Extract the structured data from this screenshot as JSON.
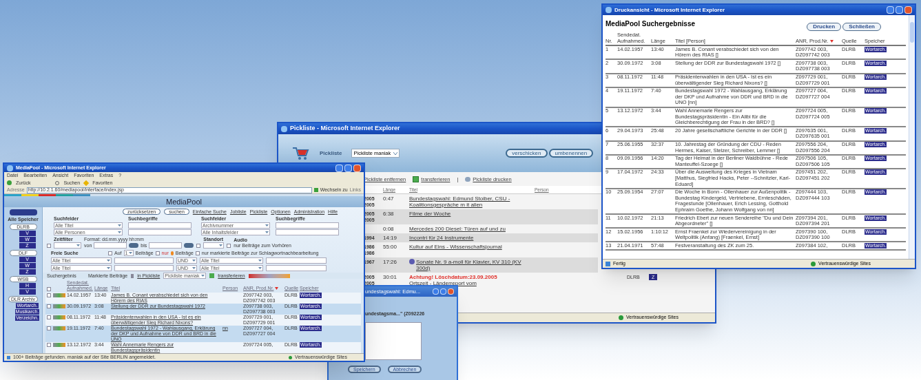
{
  "print_window": {
    "title": "Druckansicht - Microsoft Internet Explorer",
    "heading": "MediaPool Suchergebnisse",
    "buttons": [
      "Drucken",
      "Schließen"
    ],
    "columns": [
      {
        "label": "Nr.",
        "sorted": false
      },
      {
        "label": "Sendedat. Aufnahmed.",
        "sorted": false
      },
      {
        "label": "Länge",
        "sorted": false
      },
      {
        "label": "Titel [Person]",
        "sorted": false
      },
      {
        "label": "ANR, Prod.Nr.",
        "sorted": true
      },
      {
        "label": "Quelle",
        "sorted": false
      },
      {
        "label": "Speicher",
        "sorted": false
      }
    ],
    "rows": [
      {
        "nr": "1",
        "date": "14.02.1957",
        "length": "13:40",
        "title": "James B. Conant verabschiedet sich von den Hörern des RIAS []",
        "anr": "Z097742 003, DZ097742 003",
        "source": "DLRB",
        "storage": "Wortarch."
      },
      {
        "nr": "2",
        "date": "30.09.1972",
        "length": "3:08",
        "title": "Stellung der DDR zur Bundestagswahl 1972 []",
        "anr": "Z097738 003, DZ097738 003",
        "source": "DLRB",
        "storage": "Wortarch."
      },
      {
        "nr": "3",
        "date": "08.11.1972",
        "length": "11:48",
        "title": "Präsidentenwahlen in den USA - Ist es ein überwältigender Sieg Richard Nixons? []",
        "anr": "Z097729 001, DZ097729 001",
        "source": "DLRB",
        "storage": "Wortarch."
      },
      {
        "nr": "4",
        "date": "19.11.1972",
        "length": "7:40",
        "title": "Bundestagswahl 1972 - Wahlausgang, Erklärung der DKP und Aufnahme von DDR und BRD in die UNO [nn]",
        "anr": "Z097727 004, DZ097727 004",
        "source": "DLRB",
        "storage": "Wortarch."
      },
      {
        "nr": "5",
        "date": "13.12.1972",
        "length": "3:44",
        "title": "Wahl Annemarie Rengers zur Bundestagspräsidentin - Ein Alibi für die Gleichberechtigung der Frau in der BRD? []",
        "anr": "Z097724 005, DZ097724 005",
        "source": "DLRB",
        "storage": "Wortarch."
      },
      {
        "nr": "6",
        "date": "29.04.1973",
        "length": "25:48",
        "title": "20 Jahre gesellschaftliche Gerichte in der DDR []",
        "anr": "Z097635 001, DZ097635 001",
        "source": "DLRB",
        "storage": "Wortarch."
      },
      {
        "nr": "7",
        "date": "25.06.1955",
        "length": "32:37",
        "title": "10. Jahrestag der Gründung der CDU - Reden Hermes, Kaiser, Stelzer, Schreiber, Lemmer []",
        "anr": "Z097556 204, DZ097556 204",
        "source": "DLRB",
        "storage": "Wortarch."
      },
      {
        "nr": "8",
        "date": "09.09.1956",
        "length": "14:20",
        "title": "Tag der Heimat in der Berliner Waldbühne - Rede Manteuffel-Szoege []",
        "anr": "Z097506 105, DZ097506 105",
        "source": "DLRB",
        "storage": "Wortarch."
      },
      {
        "nr": "9",
        "date": "17.04.1972",
        "length": "24:33",
        "title": "Über die Ausweitung des Krieges in Vietnam [Matthus, Siegfried Hacks, Peter --Schnitzler, Karl-Eduard]",
        "anr": "Z097451 202, DZ097451 202",
        "source": "DLRB",
        "storage": "Wortarch."
      },
      {
        "nr": "10",
        "date": "25.09.1954",
        "length": "27:07",
        "title": "Die Woche in Bonn - Ollenhauer zur Außenpolitik - Bundestag Kindergeld, Vertriebene, Ernteschäden, Fragestunde [Ollenhauer, Erich Lessing, Gotthold Ephraim Goethe, Johann Wolfgang von nn]",
        "anr": "Z097444 103, DZ097444 103",
        "source": "DLRB",
        "storage": "Wortarch."
      },
      {
        "nr": "11",
        "date": "10.02.1972",
        "length": "21:13",
        "title": "Friedrich Ebert zur neuen Sendereihe \"Du und Dein Abgeordneter\" []",
        "anr": "Z097394 201, DZ097394 201",
        "source": "DLRB",
        "storage": "Wortarch."
      },
      {
        "nr": "12",
        "date": "15.02.1956",
        "length": "1:10:12",
        "title": "Ernst Fraenkel zur Wiedervereinigung in der Weltpolitik (Anfang) [Fraenkel, Ernst]",
        "anr": "Z097390 100, DZ097390 100",
        "source": "DLRB",
        "storage": "Wortarch."
      },
      {
        "nr": "13",
        "date": "21.04.1971",
        "length": "57:48",
        "title": "Festveranstaltung des ZK zum 25.",
        "anr": "Z097384 102,",
        "source": "DLRB",
        "storage": "Wortarch."
      }
    ],
    "status": "Fertig",
    "zone": "Vertrauenswürdige Sites"
  },
  "pick_window": {
    "title": "Pickliste - Microsoft Internet Explorer",
    "label": "Pickliste",
    "select": "Pickliste maniak",
    "buttons": [
      "verschicken",
      "umbenennen"
    ],
    "actions": [
      "Pickliste entfernen",
      "transferieren",
      "Pickliste drucken"
    ],
    "separator": "|",
    "columns": [
      "Länge",
      "Titel",
      "Person"
    ],
    "rows": [
      {
        "years": "2005 2005",
        "length": "0:47",
        "title": "Bundestagswahl: Edmund Stoiber, CSU - Koalitionsgespräche m it allen",
        "shaded": false
      },
      {
        "years": "2005 2005",
        "length": "6:38",
        "title": "Filme der Woche",
        "shaded": true
      },
      {
        "length": "0:08",
        "title": "Mercedes 200 Diesel: Türen auf und zu",
        "shaded": false
      },
      {
        "years": "1994",
        "length": "14:19",
        "title": "Incontri für 24 Instrumente",
        "shaded": true
      },
      {
        "years": "1986 1986",
        "length": "55:00",
        "title": "Kultur auf Eins - Wissenschaftsjournal",
        "shaded": false
      },
      {
        "years": "1967",
        "length": "17:26",
        "title": "Sonate Nr. 9 a-moll für Klavier, KV 310 (KV 300d)",
        "kind": "music",
        "shaded": true
      },
      {
        "years": "2005 2005",
        "length": "30:01",
        "warning": "Achtung! Löschdatum:23.09.2005",
        "title": "Ortszeit - Länderreport vom",
        "source": "DLRB",
        "storage": "Z",
        "shaded": false
      }
    ],
    "zone": "Vertrauenswürdige Sites"
  },
  "dialog": {
    "title": "undestagswahl: Edmu...",
    "label": "undestagsma...\" (Z092226",
    "buttons": [
      "Speichern",
      "Abbrechen"
    ]
  },
  "main_window": {
    "title": "MediaPool - Microsoft Internet Explorer",
    "menu": [
      "Datei",
      "Bearbeiten",
      "Ansicht",
      "Favoriten",
      "Extras",
      "?"
    ],
    "toolbar": [
      "Zurück",
      "Suchen",
      "Favoriten"
    ],
    "address_label": "Adresse",
    "url": "http://10.2.1.60/mediapool/interface/index.jsp",
    "go": "Wechseln zu",
    "links": "Links",
    "heading": "MediaPool",
    "all_storages": "Alle Speicher",
    "sidebar": [
      {
        "label": "DLRB",
        "children": [
          "V",
          "W",
          "Z"
        ]
      },
      {
        "label": "DLF",
        "children": [
          "V",
          "W",
          "Z"
        ]
      },
      {
        "label": "WSB",
        "children": [
          "H",
          "V"
        ]
      },
      {
        "label": "DLR Archiv",
        "children": [
          "Wortarch.",
          "Musikarch.",
          "Verzeichn."
        ]
      }
    ],
    "nav_buttons": [
      "zurücksetzen",
      "suchen"
    ],
    "nav_links": [
      "Einfache Suche",
      "Jobliste",
      "Pickliste",
      "Optionen",
      "Administration",
      "Hilfe"
    ],
    "search_groups": [
      {
        "fields_label": "Suchfelder",
        "terms_label": "Suchbegriffe",
        "fields": [
          "Alle Titel",
          "Alle Personen"
        ]
      },
      {
        "fields_label": "Suchfelder",
        "terms_label": "Suchbegriffe",
        "fields": [
          "Archivnummer",
          "Alle Inhaltsfelder"
        ]
      }
    ],
    "time_filter": {
      "label": "Zeitfilter",
      "enabled": false,
      "format": "Format: dd.mm.yyyy hh:mm",
      "from": "von",
      "to": "bis",
      "location": "Standort",
      "location_checked": false,
      "audio": "Audio",
      "audio_option": "nur Beiträge zum Vorhören",
      "checked": false
    },
    "free_search": {
      "label": "Freie Suche",
      "on_checked": false,
      "on": "Auf",
      "count": "1",
      "items": "Beiträge",
      "only_checked": false,
      "only": "nur",
      "only_items": "Beiträge",
      "marked_checked": false,
      "marked_option": "nur markierte Beiträge zur Schlagwortnachbearbeitung",
      "rows": [
        {
          "field": "Alle Titel",
          "op": "UND",
          "field2": "Alle Titel"
        },
        {
          "field": "Alle Titel",
          "op": "UND",
          "field2": "Alle Titel"
        }
      ]
    },
    "select_all_checked": false,
    "results_label": "Suchergebnis",
    "marked_label": "Markierte Beiträge",
    "to_picklist": "in Pickliste",
    "picklist": "Pickliste maniak",
    "transfer": "transferieren",
    "columns": [
      {
        "label": "Sendedat. Aufnahmed.",
        "sorted": false
      },
      {
        "label": "Länge",
        "sorted": false
      },
      {
        "label": "Titel",
        "sorted": false
      },
      {
        "label": "Person",
        "sorted": false
      },
      {
        "label": "ANR, Prod.Nr.",
        "sorted": true
      },
      {
        "label": "Quelle",
        "sorted": false
      },
      {
        "label": "Speicher",
        "sorted": false
      }
    ],
    "rows": [
      {
        "checked": false,
        "date": "14.02.1957",
        "length": "13:40",
        "title": "James B. Conant verabschiedet sich von den Hörern des RIAS",
        "anr": "Z097742 003, DZ097742 003",
        "source": "DLRB",
        "storage": "Wortarch.",
        "selected": false
      },
      {
        "checked": false,
        "date": "30.09.1972",
        "length": "3:08",
        "title": "Stellung der DDR zur Bundestagswahl 1972",
        "anr": "Z097738 003, DZ097738 003",
        "source": "DLRB",
        "storage": "Wortarch.",
        "selected": true
      },
      {
        "checked": false,
        "date": "08.11.1972",
        "length": "11:48",
        "title": "Präsidentenwahlen in den USA - Ist es ein überwältigender Sieg Richard Nixons?",
        "anr": "Z097729 001, DZ097729 001",
        "source": "DLRB",
        "storage": "Wortarch.",
        "selected": false
      },
      {
        "checked": false,
        "date": "19.11.1972",
        "length": "7:40",
        "title": "Bundestagswahl 1972 - Wahlausgang, Erklärung der DKP und Aufnahme von DDR und BRD in die UNO",
        "person": "nn",
        "anr": "Z097727 004, DZ097727 004",
        "source": "DLRB",
        "storage": "Wortarch.",
        "selected": true
      },
      {
        "checked": false,
        "date": "13.12.1972",
        "length": "3:44",
        "title": "Wahl Annemarie Rengers zur Bundestagspräsidentin",
        "anr": "Z097724 005,",
        "source": "DLRB",
        "storage": "Wortarch.",
        "selected": false
      }
    ],
    "status": "100+ Beiträge gefunden. maniak auf der Site BERLIN angemeldet.",
    "zone": "Vertrauenswürdige Sites"
  }
}
